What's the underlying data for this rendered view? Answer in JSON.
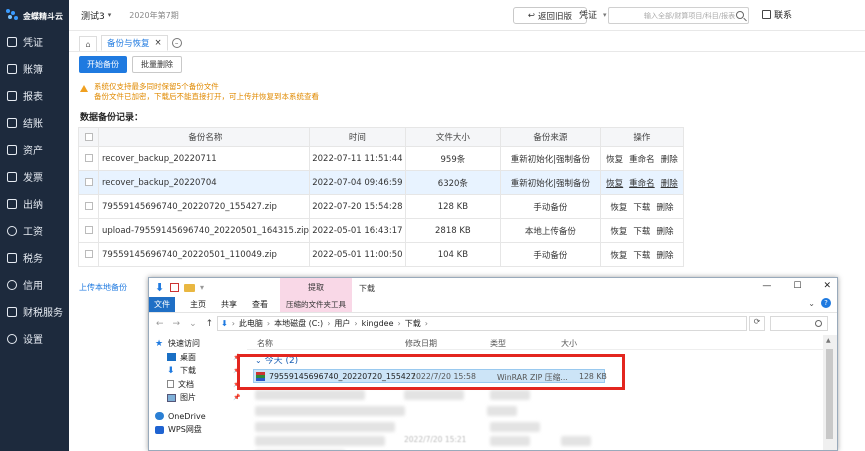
{
  "brand": {
    "name": "金蝶精斗云"
  },
  "sidebar": {
    "items": [
      {
        "label": "凭证",
        "icon": "voucher-icon"
      },
      {
        "label": "账簿",
        "icon": "ledger-icon"
      },
      {
        "label": "报表",
        "icon": "report-icon"
      },
      {
        "label": "结账",
        "icon": "close-period-icon"
      },
      {
        "label": "资产",
        "icon": "asset-icon"
      },
      {
        "label": "发票",
        "icon": "invoice-icon"
      },
      {
        "label": "出纳",
        "icon": "cashier-icon"
      },
      {
        "label": "工资",
        "icon": "salary-icon"
      },
      {
        "label": "税务",
        "icon": "tax-icon"
      },
      {
        "label": "信用",
        "icon": "credit-icon"
      },
      {
        "label": "财税服务",
        "icon": "service-icon"
      },
      {
        "label": "设置",
        "icon": "settings-icon"
      }
    ]
  },
  "header": {
    "account": "测试3",
    "period": "2020年第7期",
    "back_label": "返回旧版",
    "voucher_select": "凭证",
    "search_placeholder": "输入全部/财算项目/科目/报表",
    "contact": "联系"
  },
  "tabs": {
    "active": "备份与恢复"
  },
  "toolbar": {
    "start_backup": "开始备份",
    "batch_delete": "批量删除"
  },
  "warning": {
    "line1": "系统仅支持最多同时保留5个备份文件",
    "line2": "备份文件已加密，下载后不能直接打开，可上传并恢复到本系统查看"
  },
  "records": {
    "title": "数据备份记录：",
    "columns": [
      "备份名称",
      "时间",
      "文件大小",
      "备份来源",
      "操作"
    ],
    "rows": [
      {
        "name": "recover_backup_20220711",
        "time": "2022-07-11 11:51:44",
        "size": "959条",
        "source": "重新初始化|强制备份",
        "ops": [
          "恢复",
          "重命名",
          "删除"
        ]
      },
      {
        "name": "recover_backup_20220704",
        "time": "2022-07-04 09:46:59",
        "size": "6320条",
        "source": "重新初始化|强制备份",
        "ops": [
          "恢复",
          "重命名",
          "删除"
        ]
      },
      {
        "name": "79559145696740_20220720_155427.zip",
        "time": "2022-07-20 15:54:28",
        "size": "128 KB",
        "source": "手动备份",
        "ops": [
          "恢复",
          "下载",
          "删除"
        ]
      },
      {
        "name": "upload-79559145696740_20220501_164315.zip",
        "time": "2022-05-01 16:43:17",
        "size": "2818 KB",
        "source": "本地上传备份",
        "ops": [
          "恢复",
          "下载",
          "删除"
        ]
      },
      {
        "name": "79559145696740_20220501_110049.zip",
        "time": "2022-05-01 11:00:50",
        "size": "104 KB",
        "source": "手动备份",
        "ops": [
          "恢复",
          "下载",
          "删除"
        ]
      }
    ]
  },
  "upload_link": "上传本地备份",
  "explorer": {
    "ribbon_tab": "提取",
    "title": "下载",
    "menu": {
      "file": "文件",
      "home": "主页",
      "share": "共享",
      "view": "查看",
      "tools": "压缩的文件夹工具"
    },
    "address": [
      "此电脑",
      "本地磁盘 (C:)",
      "用户",
      "kingdee",
      "下载"
    ],
    "columns": {
      "name": "名称",
      "modified": "修改日期",
      "type": "类型",
      "size": "大小"
    },
    "group": "今天 (2)",
    "file": {
      "name": "79559145696740_20220720_155427",
      "date": "2022/7/20 15:58",
      "type": "WinRAR ZIP 压缩...",
      "size": "128 KB"
    },
    "nav": [
      {
        "label": "快速访问",
        "icon": "quick-access-icon"
      },
      {
        "label": "桌面",
        "icon": "desktop-icon"
      },
      {
        "label": "下载",
        "icon": "download-icon"
      },
      {
        "label": "文档",
        "icon": "document-icon"
      },
      {
        "label": "图片",
        "icon": "picture-icon"
      },
      {
        "label": "OneDrive",
        "icon": "onedrive-icon"
      },
      {
        "label": "WPS网盘",
        "icon": "wps-cloud-icon"
      }
    ],
    "blurred_date": "2022/7/20 15:21"
  }
}
